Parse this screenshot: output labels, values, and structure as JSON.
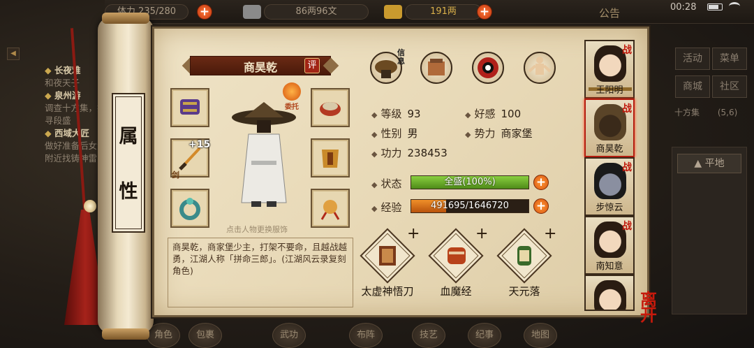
{
  "topbar": {
    "stamina": "体力 235/280",
    "copper": "86两96文",
    "gold": "191两",
    "announce": "公告",
    "time": "00:28"
  },
  "quests": [
    {
      "title": "长夜难",
      "desc": "和夜天子"
    },
    {
      "title": "泉州游",
      "desc": "调查十方集，搜寻段盛"
    },
    {
      "title": "西域大匠",
      "desc": "做好准备后女满附近找铸神雷"
    }
  ],
  "right_menu": {
    "buttons": [
      "活动",
      "菜单",
      "商城",
      "社区"
    ],
    "location": "十方集",
    "coords": "(5,6)",
    "terrain": "平地"
  },
  "scroll_label": [
    "属",
    "性"
  ],
  "character": {
    "name": "商昊乾",
    "rate_label": "评",
    "consign_label": "委托",
    "hint": "点击人物更换服饰",
    "weapon_refine": "+15",
    "weapon_tag": "剑",
    "description": "商昊乾，商家堡少主，打架不要命，且越战越勇，江湖人称「拼命三郎」。(江湖风云录复刻角色)"
  },
  "tabs": [
    "信息",
    "装备",
    "八卦",
    "经脉"
  ],
  "stats": {
    "level_label": "等级",
    "level": "93",
    "affinity_label": "好感",
    "affinity": "100",
    "gender_label": "性别",
    "gender": "男",
    "faction_label": "势力",
    "faction": "商家堡",
    "power_label": "功力",
    "power": "238453",
    "state_label": "状态",
    "state_text": "全盛(100%)",
    "state_pct": 1.0,
    "exp_label": "经验",
    "exp_text": "491695/1646720",
    "exp_pct": 0.2986
  },
  "skills": [
    "太虚神悟刀",
    "血魔经",
    "天元落"
  ],
  "roster": [
    {
      "name": "王阳明",
      "tag": "战"
    },
    {
      "name": "商昊乾",
      "tag": "战"
    },
    {
      "name": "步惊云",
      "tag": "战"
    },
    {
      "name": "南知意",
      "tag": "战"
    },
    {
      "name": "",
      "tag": ""
    }
  ],
  "leave_label": "离开",
  "bottom_menu": [
    "角色",
    "包裹",
    "武功",
    "布阵",
    "技艺",
    "纪事",
    "地图"
  ],
  "colors": {
    "state_fill": "#6fae2a",
    "exp_fill": "#d06a14",
    "accent_red": "#b31d10"
  }
}
